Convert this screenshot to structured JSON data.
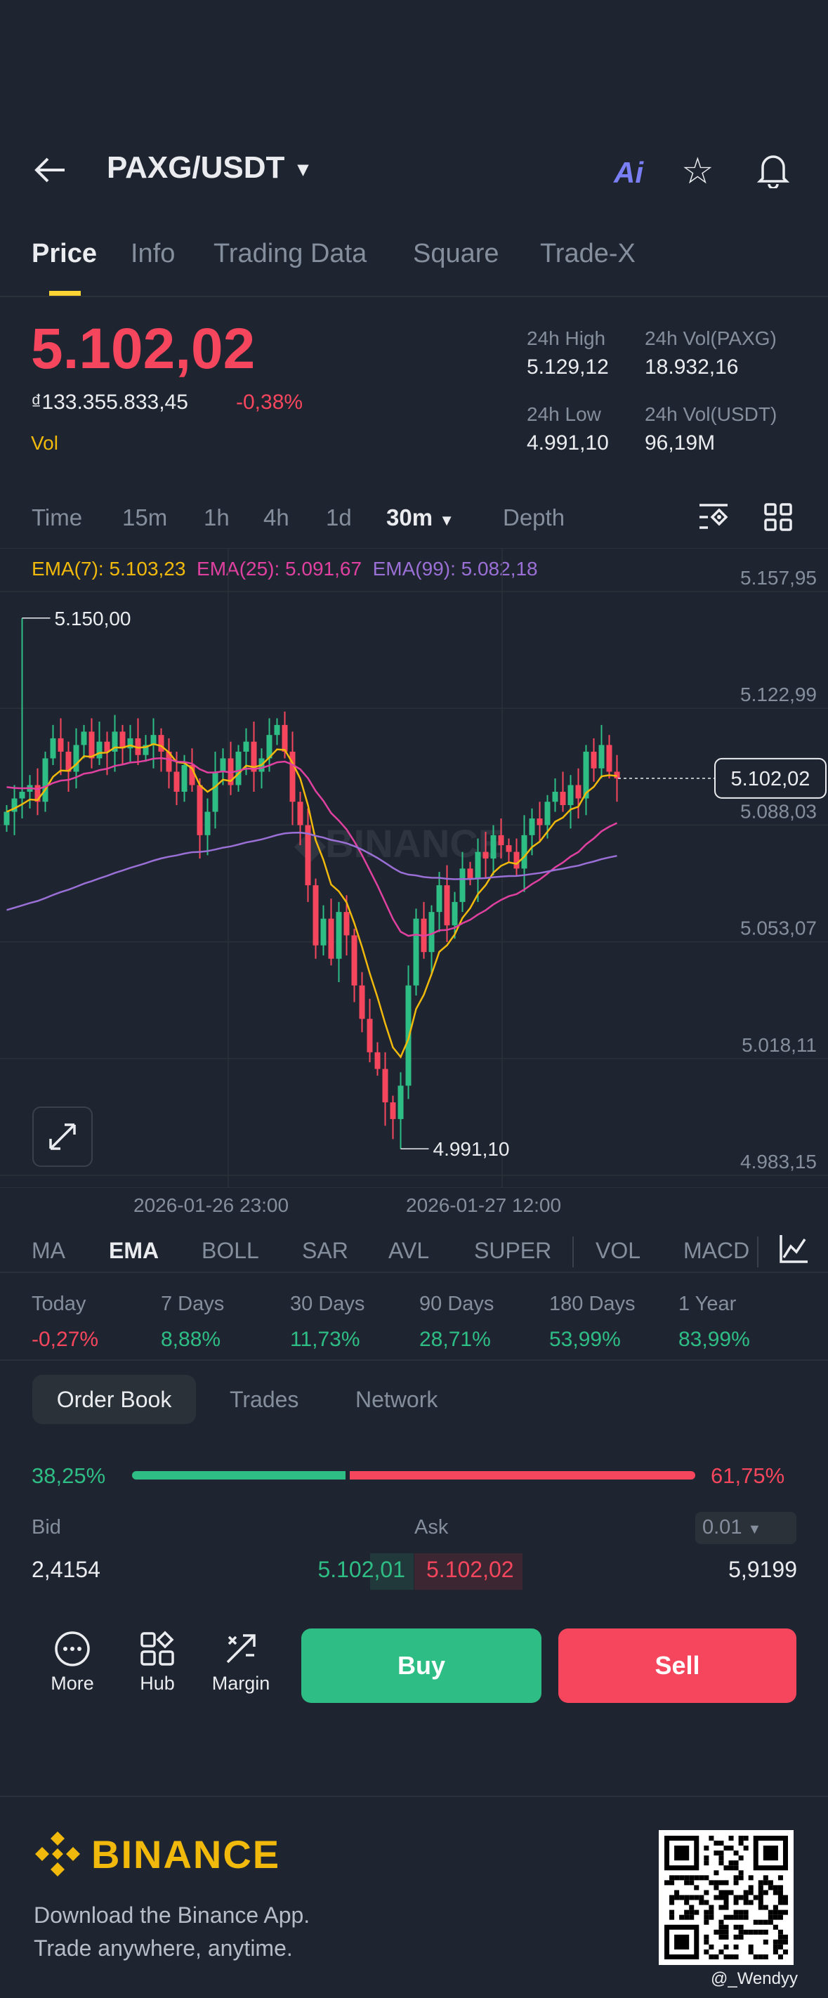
{
  "header": {
    "pair": "PAXG/USDT",
    "ai_label": "Ai"
  },
  "tabs": [
    "Price",
    "Info",
    "Trading Data",
    "Square",
    "Trade-X"
  ],
  "price": {
    "last": "5.102,02",
    "fiat": "₫133.355.833,45",
    "change": "-0,38%",
    "vol_label": "Vol"
  },
  "stats": {
    "high_label": "24h High",
    "high": "5.129,12",
    "vol_base_label": "24h Vol(PAXG)",
    "vol_base": "18.932,16",
    "low_label": "24h Low",
    "low": "4.991,10",
    "vol_quote_label": "24h Vol(USDT)",
    "vol_quote": "96,19M"
  },
  "timeframes": [
    "Time",
    "15m",
    "1h",
    "4h",
    "1d",
    "30m",
    "Depth"
  ],
  "ema": {
    "ema7": "EMA(7): 5.103,23",
    "ema25": "EMA(25): 5.091,67",
    "ema99": "EMA(99): 5.082,18"
  },
  "colors": {
    "up": "#2ebd85",
    "down": "#f6465d",
    "ema7": "#f0b90b",
    "ema25": "#e040a0",
    "ema99": "#9a6fd6",
    "accent": "#fcd535"
  },
  "chart_data": {
    "type": "candlestick",
    "y_ticks": [
      "5.157,95",
      "5.122,99",
      "5.088,03",
      "5.053,07",
      "5.018,11",
      "4.983,15"
    ],
    "ylim": [
      4983.15,
      5157.95
    ],
    "x_ticks": [
      "2026-01-26 23:00",
      "2026-01-27 12:00"
    ],
    "high_marker": "5.150,00",
    "low_marker": "4.991,10",
    "current_price": "5.102,02",
    "closes": [
      5092,
      5096,
      5098,
      5100,
      5095,
      5108,
      5114,
      5110,
      5104,
      5112,
      5116,
      5108,
      5113,
      5110,
      5116,
      5111,
      5114,
      5109,
      5112,
      5115,
      5110,
      5104,
      5098,
      5106,
      5100,
      5085,
      5092,
      5104,
      5108,
      5100,
      5110,
      5113,
      5104,
      5108,
      5115,
      5118,
      5110,
      5095,
      5088,
      5070,
      5052,
      5060,
      5048,
      5062,
      5055,
      5040,
      5030,
      5020,
      5015,
      5005,
      5000,
      5010,
      5040,
      5060,
      5050,
      5062,
      5070,
      5058,
      5065,
      5075,
      5072,
      5080,
      5078,
      5085,
      5082,
      5080,
      5075,
      5085,
      5090,
      5088,
      5095,
      5098,
      5094,
      5100,
      5096,
      5110,
      5105,
      5112,
      5104,
      5102
    ]
  },
  "indicators": [
    "MA",
    "EMA",
    "BOLL",
    "SAR",
    "AVL",
    "SUPER",
    "VOL",
    "MACD"
  ],
  "performance": [
    {
      "label": "Today",
      "value": "-0,27%"
    },
    {
      "label": "7 Days",
      "value": "8,88%"
    },
    {
      "label": "30 Days",
      "value": "11,73%"
    },
    {
      "label": "90 Days",
      "value": "28,71%"
    },
    {
      "label": "180 Days",
      "value": "53,99%"
    },
    {
      "label": "1 Year",
      "value": "83,99%"
    }
  ],
  "book_tabs": [
    "Order Book",
    "Trades",
    "Network"
  ],
  "book": {
    "bid_pct": "38,25%",
    "ask_pct": "61,75%",
    "bid_ratio": 38.25,
    "bid_label": "Bid",
    "ask_label": "Ask",
    "precision": "0.01",
    "rows": [
      {
        "bid_qty": "2,4154",
        "bid": "5.102,01",
        "ask": "5.102,02",
        "ask_qty": "5,9199"
      }
    ]
  },
  "actions": {
    "more": "More",
    "hub": "Hub",
    "margin": "Margin",
    "buy": "Buy",
    "sell": "Sell"
  },
  "footer": {
    "brand": "BINANCE",
    "line1": "Download the Binance App.",
    "line2": "Trade anywhere, anytime.",
    "credit": "@_Wendyy"
  }
}
